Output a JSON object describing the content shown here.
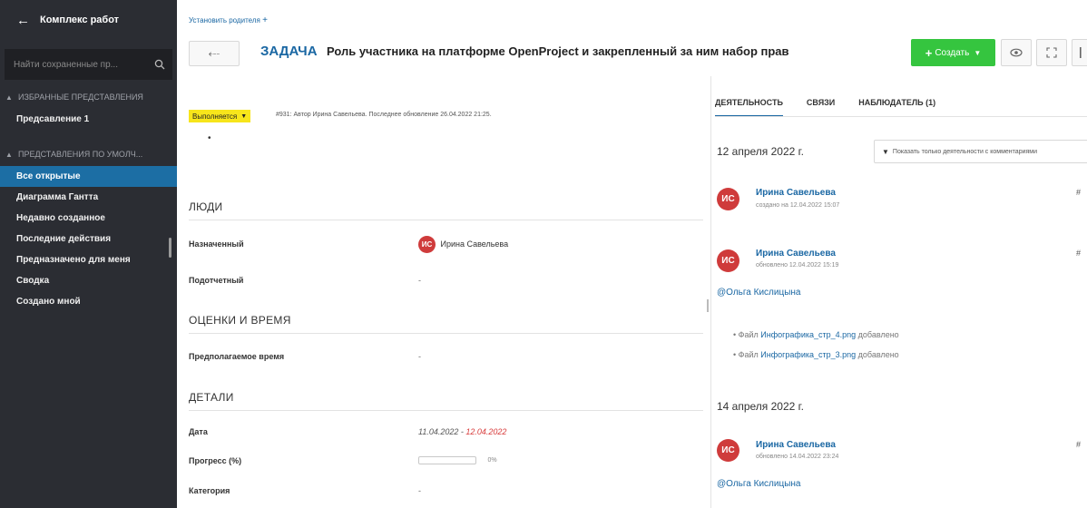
{
  "sidebar": {
    "back_glyph": "←",
    "title": "Комплекс работ",
    "search_placeholder": "Найти сохраненные пр...",
    "favorites_header": "ИЗБРАННЫЕ ПРЕДСТАВЛЕНИЯ",
    "favorites": [
      "Предсавление 1"
    ],
    "defaults_header": "ПРЕДСТАВЛЕНИЯ ПО УМОЛЧ...",
    "defaults": [
      "Все открытые",
      "Диаграмма Гантта",
      "Недавно созданное",
      "Последние действия",
      "Предназначено для меня",
      "Сводка",
      "Создано мной"
    ],
    "active_item": "Все открытые"
  },
  "header": {
    "parent_link": "Установить родителя",
    "parent_plus": "+",
    "back_glyph": "⤎",
    "type": "ЗАДАЧА",
    "subject": "Роль участника на платформе OpenProject и закрепленный за ним набор прав",
    "create_label": "Создать",
    "create_plus": "+",
    "create_caret": "▼"
  },
  "status": {
    "label": "Выполняется",
    "caret": "▼",
    "meta": "#931: Автор Ирина Савельева. Последнее обновление 26.04.2022 21:25.",
    "bullet": "•"
  },
  "sections": {
    "people": "ЛЮДИ",
    "estimates": "ОЦЕНКИ И ВРЕМЯ",
    "details": "ДЕТАЛИ"
  },
  "fields": {
    "assignee_label": "Назначенный",
    "assignee_initials": "ИС",
    "assignee_name": "Ирина Савельева",
    "accountable_label": "Подотчетный",
    "accountable_value": "-",
    "estimated_label": "Предполагаемое время",
    "estimated_value": "-",
    "date_label": "Дата",
    "date_start": "11.04.2022",
    "date_sep": " - ",
    "date_end": "12.04.2022",
    "progress_label": "Прогресс (%)",
    "progress_value": 0,
    "progress_text": "0%",
    "category_label": "Категория",
    "category_value": "-"
  },
  "activity": {
    "tabs": [
      "ДЕЯТЕЛЬНОСТЬ",
      "СВЯЗИ",
      "НАБЛЮДАТЕЛЬ (1)"
    ],
    "active_tab": 0,
    "filter_label": "Показать только деятельности с комментариями",
    "filter_glyph": "▼",
    "day1": "12 апреля 2022 г.",
    "day2": "14 апреля 2022 г.",
    "entries": [
      {
        "initials": "ИС",
        "author": "Ирина Савельева",
        "time": "создано на 12.04.2022 15:07",
        "hash": "#"
      },
      {
        "initials": "ИС",
        "author": "Ирина Савельева",
        "time": "обновлено 12.04.2022 15:19",
        "hash": "#",
        "mention": "@Ольга Кислицына"
      },
      {
        "initials": "ИС",
        "author": "Ирина Савельева",
        "time": "обновлено 14.04.2022 23:24",
        "hash": "#",
        "mention": "@Ольга Кислицына"
      }
    ],
    "changes": [
      {
        "prefix": "• Файл ",
        "file": "Инфографика_стр_4.png",
        "suffix": " добавлено"
      },
      {
        "prefix": "• Файл ",
        "file": "Инфографика_стр_3.png",
        "suffix": " добавлено"
      }
    ]
  },
  "icons": {
    "search": "search-icon",
    "eye": "eye-icon",
    "fullscreen": "fullscreen-icon",
    "more": "more-icon"
  }
}
